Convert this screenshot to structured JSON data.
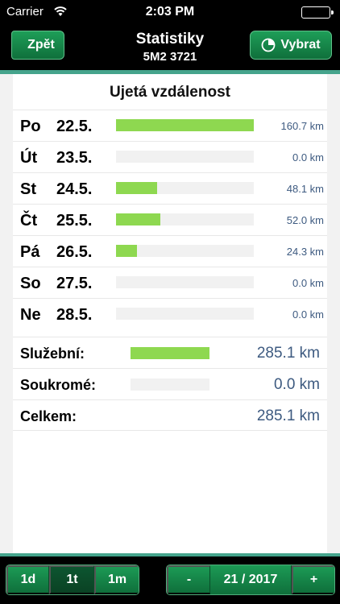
{
  "status": {
    "carrier": "Carrier",
    "time": "2:03 PM"
  },
  "nav": {
    "back_label": "Zpět",
    "title": "Statistiky",
    "subtitle": "5M2 3721",
    "select_label": "Vybrat"
  },
  "section_title": "Ujetá vzdálenost",
  "days": [
    {
      "name": "Po",
      "date": "22.5.",
      "value": "160.7 km",
      "km": 160.7
    },
    {
      "name": "Út",
      "date": "23.5.",
      "value": "0.0 km",
      "km": 0.0
    },
    {
      "name": "St",
      "date": "24.5.",
      "value": "48.1 km",
      "km": 48.1
    },
    {
      "name": "Čt",
      "date": "25.5.",
      "value": "52.0 km",
      "km": 52.0
    },
    {
      "name": "Pá",
      "date": "26.5.",
      "value": "24.3 km",
      "km": 24.3
    },
    {
      "name": "So",
      "date": "27.5.",
      "value": "0.0 km",
      "km": 0.0
    },
    {
      "name": "Ne",
      "date": "28.5.",
      "value": "0.0 km",
      "km": 0.0
    }
  ],
  "summary": [
    {
      "label": "Služební:",
      "value": "285.1 km",
      "km": 285.1,
      "has_bar": true
    },
    {
      "label": "Soukromé:",
      "value": "0.0 km",
      "km": 0.0,
      "has_bar": true
    },
    {
      "label": "Celkem:",
      "value": "285.1 km",
      "km": 285.1,
      "has_bar": false
    }
  ],
  "period_buttons": [
    {
      "label": "1d",
      "active": false
    },
    {
      "label": "1t",
      "active": true
    },
    {
      "label": "1m",
      "active": false
    }
  ],
  "period_nav": {
    "prev_label": "-",
    "current": "21 / 2017",
    "next_label": "+"
  },
  "colors": {
    "bar": "#8ed850",
    "accent": "#45a48c",
    "button": "#12814a",
    "value_text": "#3d5a80"
  }
}
